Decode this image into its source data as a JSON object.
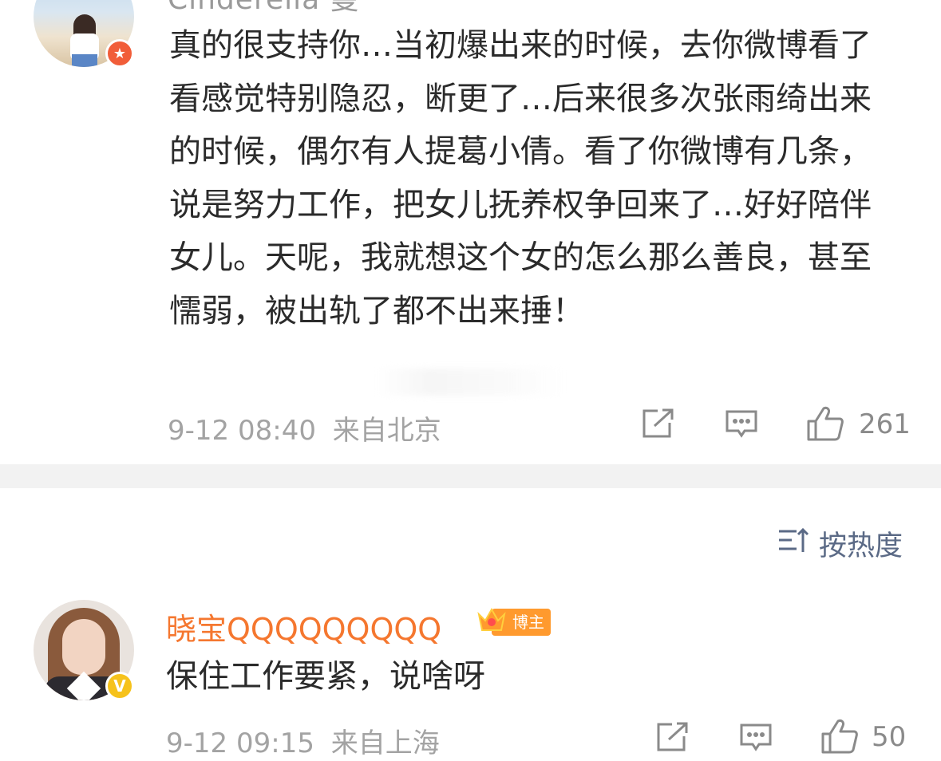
{
  "comment1": {
    "username": "Cinderella 曼",
    "badge_icon": "star-badge-icon",
    "text": "真的很支持你…当初爆出来的时候，去你微博看了看感觉特别隐忍，断更了…后来很多次张雨绮出来的时候，偶尔有人提葛小倩。看了你微博有几条，说是努力工作，把女儿抚养权争回来了…好好陪伴女儿。天呢，我就想这个女的怎么那么善良，甚至懦弱，被出轨了都不出来捶！",
    "time": "9-12 08:40",
    "location": "来自北京",
    "likes": "261"
  },
  "sort": {
    "label": "按热度",
    "icon": "sort-icon"
  },
  "comment2": {
    "username": "晓宝QQQQQQQQQ",
    "badge_icon": "verified-v-icon",
    "owner_tag": "博主",
    "text": "保住工作要紧，说啥呀",
    "time": "9-12 09:15",
    "location": "来自上海",
    "likes": "50"
  },
  "colors": {
    "username_highlight": "#f5772f",
    "meta_text": "#a3a3a3",
    "sort_text": "#5b6a86",
    "separator": "#f2f2f2",
    "owner_tag_bg": "#ff9a2e",
    "verified_badge": "#f6c21b",
    "star_badge": "#f15d39"
  }
}
